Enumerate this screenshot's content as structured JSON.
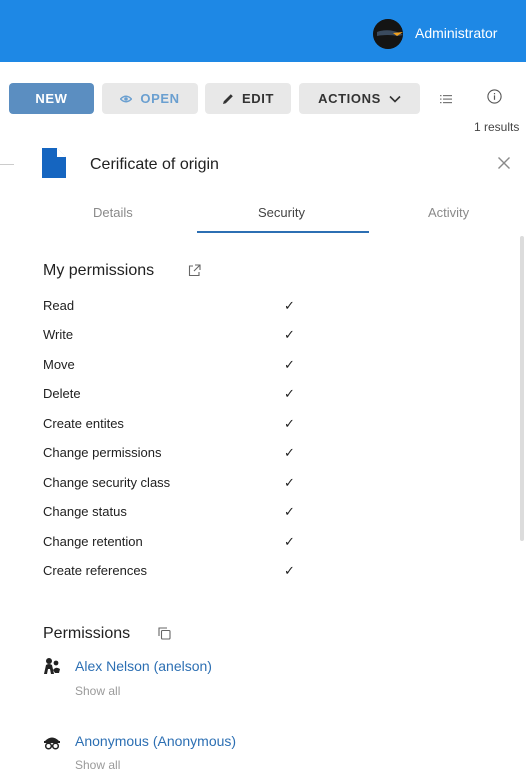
{
  "header": {
    "user_name": "Administrator",
    "brand_color": "#1e88e5"
  },
  "toolbar": {
    "new_label": "NEW",
    "open_label": "OPEN",
    "edit_label": "EDIT",
    "actions_label": "ACTIONS",
    "results_text": "1 results"
  },
  "panel": {
    "title": "Cerificate of origin",
    "tabs": [
      "Details",
      "Security",
      "Activity"
    ],
    "active_tab": "Security"
  },
  "my_permissions": {
    "title": "My permissions",
    "items": [
      {
        "label": "Read",
        "granted": "✓"
      },
      {
        "label": "Write",
        "granted": "✓"
      },
      {
        "label": "Move",
        "granted": "✓"
      },
      {
        "label": "Delete",
        "granted": "✓"
      },
      {
        "label": "Create entites",
        "granted": "✓"
      },
      {
        "label": "Change permissions",
        "granted": "✓"
      },
      {
        "label": "Change security class",
        "granted": "✓"
      },
      {
        "label": "Change status",
        "granted": "✓"
      },
      {
        "label": "Change retention",
        "granted": "✓"
      },
      {
        "label": "Create references",
        "granted": "✓"
      }
    ]
  },
  "permissions": {
    "title": "Permissions",
    "principals": [
      {
        "name": "Alex Nelson (anelson)",
        "show_all": "Show all",
        "icon": "user-group-icon"
      },
      {
        "name": "Anonymous (Anonymous)",
        "show_all": "Show all",
        "icon": "anonymous-icon"
      }
    ]
  }
}
